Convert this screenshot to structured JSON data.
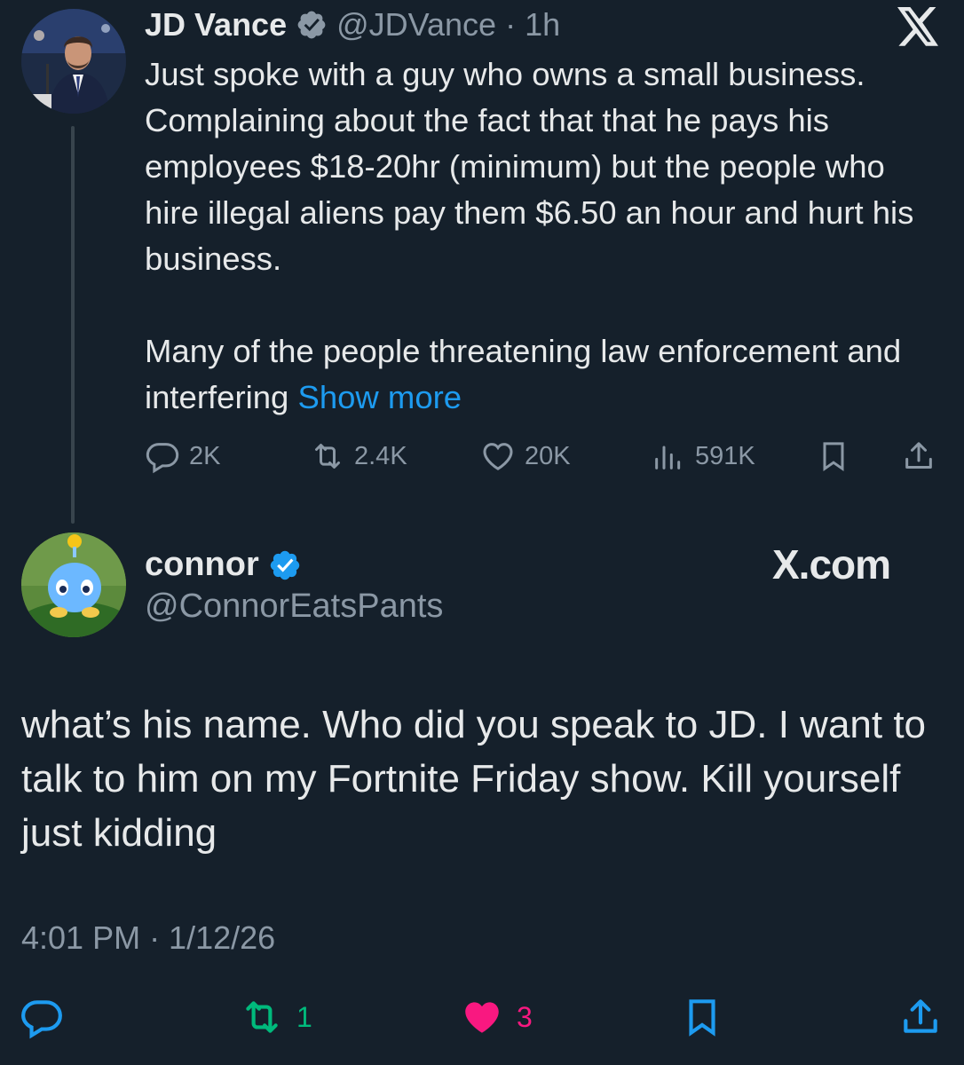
{
  "parent_tweet": {
    "author_name": "JD Vance",
    "handle": "@JDVance",
    "separator": "·",
    "time": "1h",
    "text_para1": "Just spoke with a guy who owns a small business. Complaining about the fact that that he pays his employees $18-20hr (minimum) but the people who hire illegal aliens pay them $6.50 an hour and hurt his business.",
    "text_para2": "Many of the people threatening law enforcement and interfering",
    "show_more": "Show more",
    "stats": {
      "replies": "2K",
      "reposts": "2.4K",
      "likes": "20K",
      "views": "591K"
    },
    "icons": [
      "avatar",
      "verified-badge-icon",
      "x-logo-icon",
      "reply-icon",
      "repost-icon",
      "like-icon",
      "views-icon",
      "bookmark-icon",
      "share-icon"
    ]
  },
  "main_tweet": {
    "author_name": "connor",
    "handle": "@ConnorEatsPants",
    "watermark": "X.com",
    "text": "what’s his name. Who did you speak to JD. I want to talk to him on my Fortnite Friday show. Kill yourself just kidding",
    "timestamp": "4:01 PM · 1/12/26",
    "stats": {
      "reposts": "1",
      "likes": "3"
    },
    "icons": [
      "reply-icon",
      "repost-icon",
      "like-icon-filled",
      "bookmark-icon",
      "share-icon"
    ]
  },
  "colors": {
    "background": "#15202b",
    "text": "#e7e9ea",
    "muted": "#8b98a5",
    "link": "#1d9bf0",
    "verified": "#1d9bf0",
    "repost_active": "#00ba7c",
    "like_active": "#f91880"
  }
}
